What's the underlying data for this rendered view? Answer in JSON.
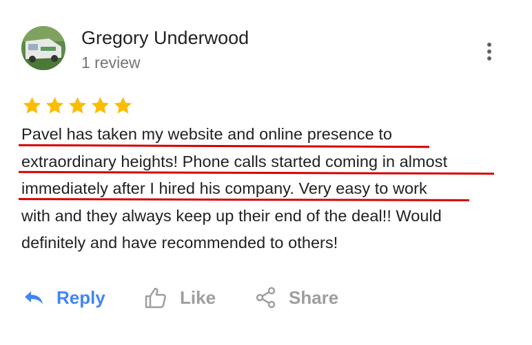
{
  "reviewer": {
    "name": "Gregory Underwood",
    "review_count": "1 review"
  },
  "rating": {
    "stars": 5,
    "max": 5,
    "star_color": "#fbbc04"
  },
  "review": {
    "lines": [
      "Pavel has taken my website and online presence to",
      "extraordinary heights! Phone calls started coming in almost",
      "immediately after I hired his company. Very easy to work",
      "with and they always keep up their end of the deal!! Would",
      "definitely and have recommended to others!"
    ],
    "underline_color": "#d50000"
  },
  "actions": {
    "reply_label": "Reply",
    "like_label": "Like",
    "share_label": "Share",
    "reply_color": "#4285f4",
    "muted_color": "#9e9e9e"
  },
  "icons": {
    "more": "more-vert-icon",
    "reply": "reply-arrow-icon",
    "like": "thumbs-up-icon",
    "share": "share-icon"
  }
}
